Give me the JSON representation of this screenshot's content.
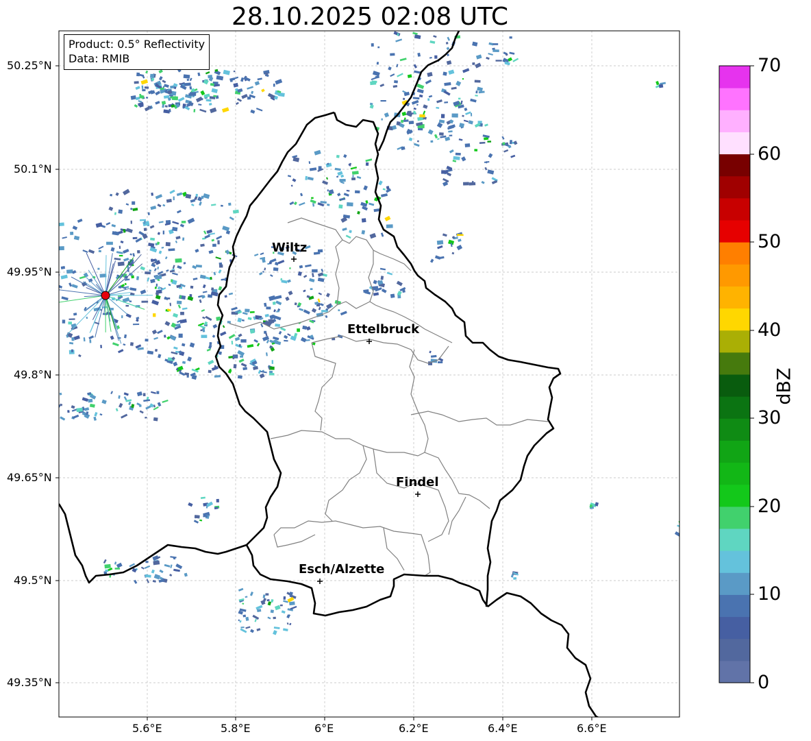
{
  "title": "28.10.2025 02:08 UTC",
  "info": {
    "product": "Product: 0.5° Reflectivity",
    "data": "Data: RMIB"
  },
  "axes": {
    "lon_ticks": [
      "5.6°E",
      "5.8°E",
      "6°E",
      "6.2°E",
      "6.4°E",
      "6.6°E"
    ],
    "lat_ticks": [
      "50.25°N",
      "50.1°N",
      "49.95°N",
      "49.8°N",
      "49.65°N",
      "49.5°N",
      "49.35°N"
    ]
  },
  "cities": [
    {
      "name": "Wiltz"
    },
    {
      "name": "Ettelbruck"
    },
    {
      "name": "Findel"
    },
    {
      "name": "Esch/Alzette"
    }
  ],
  "colorbar": {
    "label": "dBZ",
    "ticks": [
      "70",
      "60",
      "50",
      "40",
      "30",
      "20",
      "10",
      "0"
    ],
    "colors": [
      "#6173a8",
      "#52689e",
      "#465fa2",
      "#4a73b0",
      "#5a9ac6",
      "#64c2dc",
      "#5fd6c1",
      "#41d16d",
      "#13c81a",
      "#12b716",
      "#11a515",
      "#0f8b14",
      "#0b7412",
      "#095c0e",
      "#467a0d",
      "#aaaf05",
      "#ffd700",
      "#ffb300",
      "#ff9900",
      "#ff7f00",
      "#e60000",
      "#c80000",
      "#a00000",
      "#780000",
      "#ffe0ff",
      "#ffb0ff",
      "#ff73ff",
      "#e633ee"
    ]
  },
  "colors": {
    "border_country": "#000000",
    "border_canton": "#808080",
    "radar_site": "#e8000b"
  }
}
